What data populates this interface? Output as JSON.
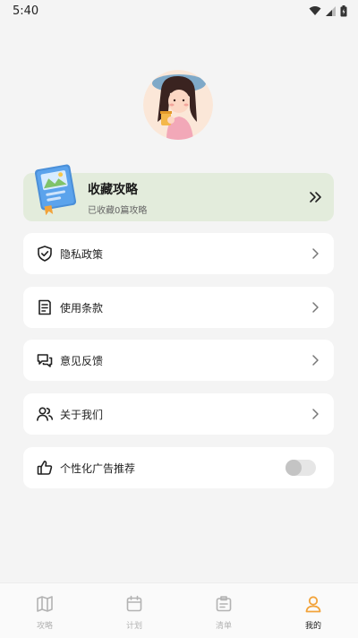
{
  "status_bar": {
    "time": "5:40"
  },
  "collect": {
    "title": "收藏攻略",
    "subtitle": "已收藏0篇攻略"
  },
  "menu": [
    {
      "label": "隐私政策",
      "icon": "shield-check-icon"
    },
    {
      "label": "使用条款",
      "icon": "document-icon"
    },
    {
      "label": "意见反馈",
      "icon": "chat-bubbles-icon"
    },
    {
      "label": "关于我们",
      "icon": "users-icon"
    }
  ],
  "ad_setting": {
    "label": "个性化广告推荐",
    "icon": "thumbs-up-icon",
    "enabled": false
  },
  "tabs": [
    {
      "label": "攻略",
      "icon": "map-icon",
      "active": false
    },
    {
      "label": "计划",
      "icon": "calendar-icon",
      "active": false
    },
    {
      "label": "清单",
      "icon": "checklist-icon",
      "active": false
    },
    {
      "label": "我的",
      "icon": "user-icon",
      "active": true
    }
  ],
  "colors": {
    "accent": "#f2a33a",
    "collect_bg": "#e3ecdc",
    "background": "#f4f4f4"
  }
}
